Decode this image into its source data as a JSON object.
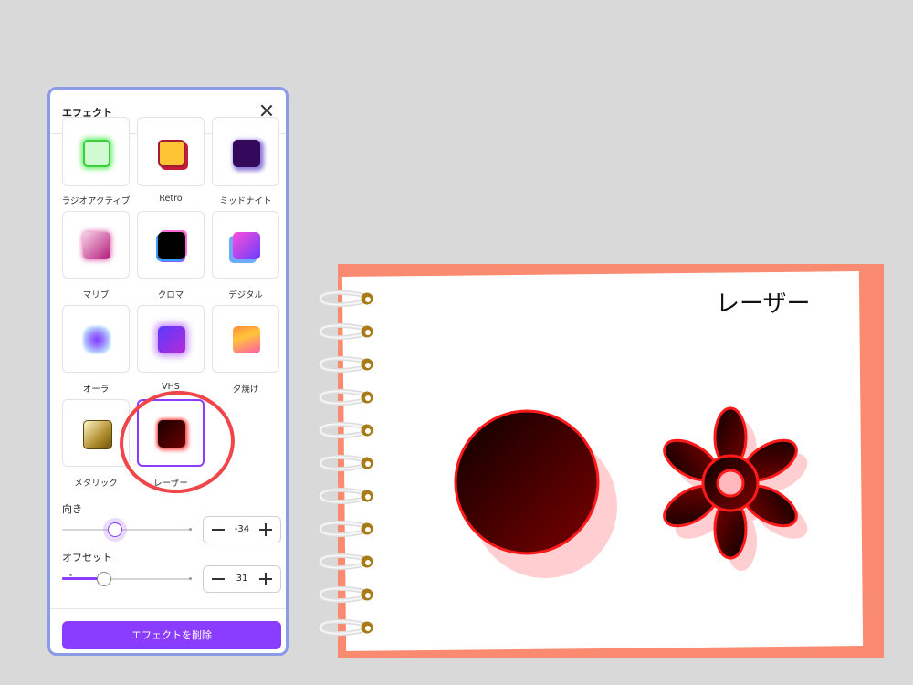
{
  "panel": {
    "title": "エフェクト",
    "effects": [
      {
        "label": "ラジオアクティブ"
      },
      {
        "label": "Retro"
      },
      {
        "label": "ミッドナイト"
      },
      {
        "label": "マリブ"
      },
      {
        "label": "クロマ"
      },
      {
        "label": "デジタル"
      },
      {
        "label": "オーラ"
      },
      {
        "label": "VHS"
      },
      {
        "label": "夕焼け"
      },
      {
        "label": "メタリック"
      },
      {
        "label": "レーザー",
        "selected": true
      }
    ],
    "direction": {
      "label": "向き",
      "value": "-34"
    },
    "offset": {
      "label": "オフセット",
      "value": "31"
    },
    "remove_button": "エフェクトを削除"
  },
  "canvas": {
    "title": "レーザー"
  },
  "colors": {
    "accent": "#8b3dff",
    "annotation": "#f0454a",
    "page_background": "#fb8b70",
    "laser_red": "#ff1a1a",
    "laser_fill_dark": "#1a0000"
  }
}
